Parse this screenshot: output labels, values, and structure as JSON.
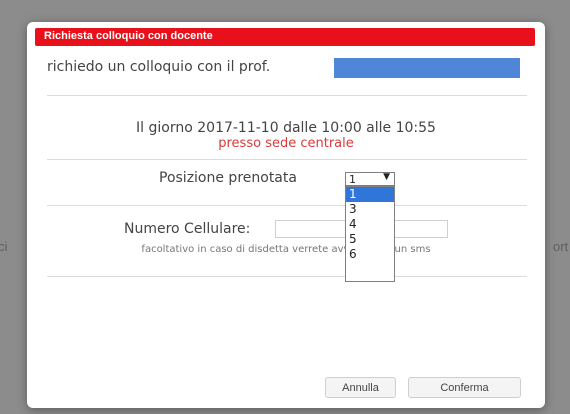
{
  "dialog": {
    "title": "Richiesta colloquio con docente",
    "teacher_prompt": "richiedo un colloquio con il prof.",
    "date_line": "Il giorno 2017-11-10 dalle 10:00 alle 10:55",
    "location_line": "presso sede centrale",
    "position_label": "Posizione prenotata",
    "position_selected": "1",
    "position_options": [
      "1",
      "3",
      "4",
      "5",
      "6"
    ],
    "cell_label": "Numero Cellulare:",
    "cell_value": "",
    "cell_note": "facoltativo in caso di disdetta verrete avvisati con un sms",
    "cancel_label": "Annulla",
    "confirm_label": "Conferma"
  },
  "colors": {
    "header": "#e8101a",
    "location_text": "#d83a3a",
    "selected_option": "#2f76d8"
  }
}
